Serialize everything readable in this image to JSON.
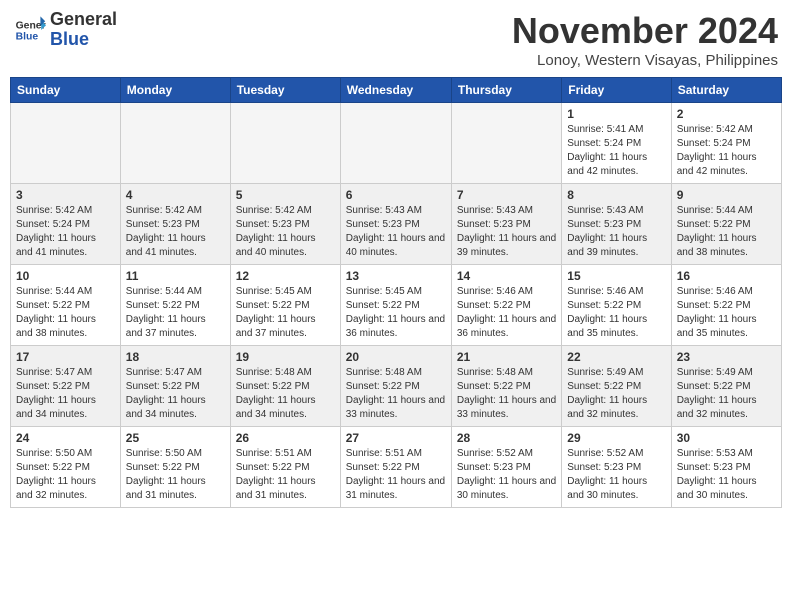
{
  "header": {
    "logo_line1": "General",
    "logo_line2": "Blue",
    "month": "November 2024",
    "location": "Lonoy, Western Visayas, Philippines"
  },
  "days_of_week": [
    "Sunday",
    "Monday",
    "Tuesday",
    "Wednesday",
    "Thursday",
    "Friday",
    "Saturday"
  ],
  "weeks": [
    [
      {
        "day": "",
        "info": ""
      },
      {
        "day": "",
        "info": ""
      },
      {
        "day": "",
        "info": ""
      },
      {
        "day": "",
        "info": ""
      },
      {
        "day": "",
        "info": ""
      },
      {
        "day": "1",
        "info": "Sunrise: 5:41 AM\nSunset: 5:24 PM\nDaylight: 11 hours and 42 minutes."
      },
      {
        "day": "2",
        "info": "Sunrise: 5:42 AM\nSunset: 5:24 PM\nDaylight: 11 hours and 42 minutes."
      }
    ],
    [
      {
        "day": "3",
        "info": "Sunrise: 5:42 AM\nSunset: 5:24 PM\nDaylight: 11 hours and 41 minutes."
      },
      {
        "day": "4",
        "info": "Sunrise: 5:42 AM\nSunset: 5:23 PM\nDaylight: 11 hours and 41 minutes."
      },
      {
        "day": "5",
        "info": "Sunrise: 5:42 AM\nSunset: 5:23 PM\nDaylight: 11 hours and 40 minutes."
      },
      {
        "day": "6",
        "info": "Sunrise: 5:43 AM\nSunset: 5:23 PM\nDaylight: 11 hours and 40 minutes."
      },
      {
        "day": "7",
        "info": "Sunrise: 5:43 AM\nSunset: 5:23 PM\nDaylight: 11 hours and 39 minutes."
      },
      {
        "day": "8",
        "info": "Sunrise: 5:43 AM\nSunset: 5:23 PM\nDaylight: 11 hours and 39 minutes."
      },
      {
        "day": "9",
        "info": "Sunrise: 5:44 AM\nSunset: 5:22 PM\nDaylight: 11 hours and 38 minutes."
      }
    ],
    [
      {
        "day": "10",
        "info": "Sunrise: 5:44 AM\nSunset: 5:22 PM\nDaylight: 11 hours and 38 minutes."
      },
      {
        "day": "11",
        "info": "Sunrise: 5:44 AM\nSunset: 5:22 PM\nDaylight: 11 hours and 37 minutes."
      },
      {
        "day": "12",
        "info": "Sunrise: 5:45 AM\nSunset: 5:22 PM\nDaylight: 11 hours and 37 minutes."
      },
      {
        "day": "13",
        "info": "Sunrise: 5:45 AM\nSunset: 5:22 PM\nDaylight: 11 hours and 36 minutes."
      },
      {
        "day": "14",
        "info": "Sunrise: 5:46 AM\nSunset: 5:22 PM\nDaylight: 11 hours and 36 minutes."
      },
      {
        "day": "15",
        "info": "Sunrise: 5:46 AM\nSunset: 5:22 PM\nDaylight: 11 hours and 35 minutes."
      },
      {
        "day": "16",
        "info": "Sunrise: 5:46 AM\nSunset: 5:22 PM\nDaylight: 11 hours and 35 minutes."
      }
    ],
    [
      {
        "day": "17",
        "info": "Sunrise: 5:47 AM\nSunset: 5:22 PM\nDaylight: 11 hours and 34 minutes."
      },
      {
        "day": "18",
        "info": "Sunrise: 5:47 AM\nSunset: 5:22 PM\nDaylight: 11 hours and 34 minutes."
      },
      {
        "day": "19",
        "info": "Sunrise: 5:48 AM\nSunset: 5:22 PM\nDaylight: 11 hours and 34 minutes."
      },
      {
        "day": "20",
        "info": "Sunrise: 5:48 AM\nSunset: 5:22 PM\nDaylight: 11 hours and 33 minutes."
      },
      {
        "day": "21",
        "info": "Sunrise: 5:48 AM\nSunset: 5:22 PM\nDaylight: 11 hours and 33 minutes."
      },
      {
        "day": "22",
        "info": "Sunrise: 5:49 AM\nSunset: 5:22 PM\nDaylight: 11 hours and 32 minutes."
      },
      {
        "day": "23",
        "info": "Sunrise: 5:49 AM\nSunset: 5:22 PM\nDaylight: 11 hours and 32 minutes."
      }
    ],
    [
      {
        "day": "24",
        "info": "Sunrise: 5:50 AM\nSunset: 5:22 PM\nDaylight: 11 hours and 32 minutes."
      },
      {
        "day": "25",
        "info": "Sunrise: 5:50 AM\nSunset: 5:22 PM\nDaylight: 11 hours and 31 minutes."
      },
      {
        "day": "26",
        "info": "Sunrise: 5:51 AM\nSunset: 5:22 PM\nDaylight: 11 hours and 31 minutes."
      },
      {
        "day": "27",
        "info": "Sunrise: 5:51 AM\nSunset: 5:22 PM\nDaylight: 11 hours and 31 minutes."
      },
      {
        "day": "28",
        "info": "Sunrise: 5:52 AM\nSunset: 5:23 PM\nDaylight: 11 hours and 30 minutes."
      },
      {
        "day": "29",
        "info": "Sunrise: 5:52 AM\nSunset: 5:23 PM\nDaylight: 11 hours and 30 minutes."
      },
      {
        "day": "30",
        "info": "Sunrise: 5:53 AM\nSunset: 5:23 PM\nDaylight: 11 hours and 30 minutes."
      }
    ]
  ]
}
